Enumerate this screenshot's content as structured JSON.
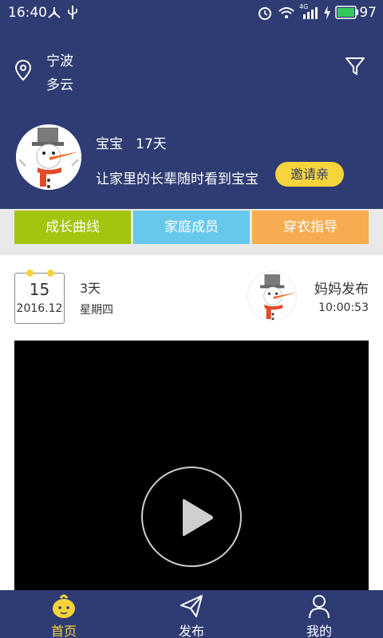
{
  "status_bar": {
    "time": "16:40",
    "battery": "97",
    "network": "4G"
  },
  "header": {
    "city": "宁波",
    "weather": "多云",
    "baby_name": "宝宝",
    "baby_age": "17天",
    "invite_text": "让家里的长辈随时看到宝宝",
    "invite_button": "邀请亲"
  },
  "tabs": [
    {
      "label": "成长曲线",
      "color": "#a2c60f"
    },
    {
      "label": "家庭成员",
      "color": "#68c8ec"
    },
    {
      "label": "穿衣指导",
      "color": "#f7ad4f"
    }
  ],
  "post": {
    "date_day": "15",
    "date_month": "2016.12",
    "days": "3天",
    "weekday": "星期四",
    "author": "妈妈发布",
    "time": "10:00:53"
  },
  "bottom_nav": [
    {
      "label": "首页",
      "icon": "baby-face-icon",
      "active": true
    },
    {
      "label": "发布",
      "icon": "paper-plane-icon",
      "active": false
    },
    {
      "label": "我的",
      "icon": "person-icon",
      "active": false
    }
  ],
  "colors": {
    "primary": "#2e3c73",
    "accent": "#f6d43b"
  }
}
